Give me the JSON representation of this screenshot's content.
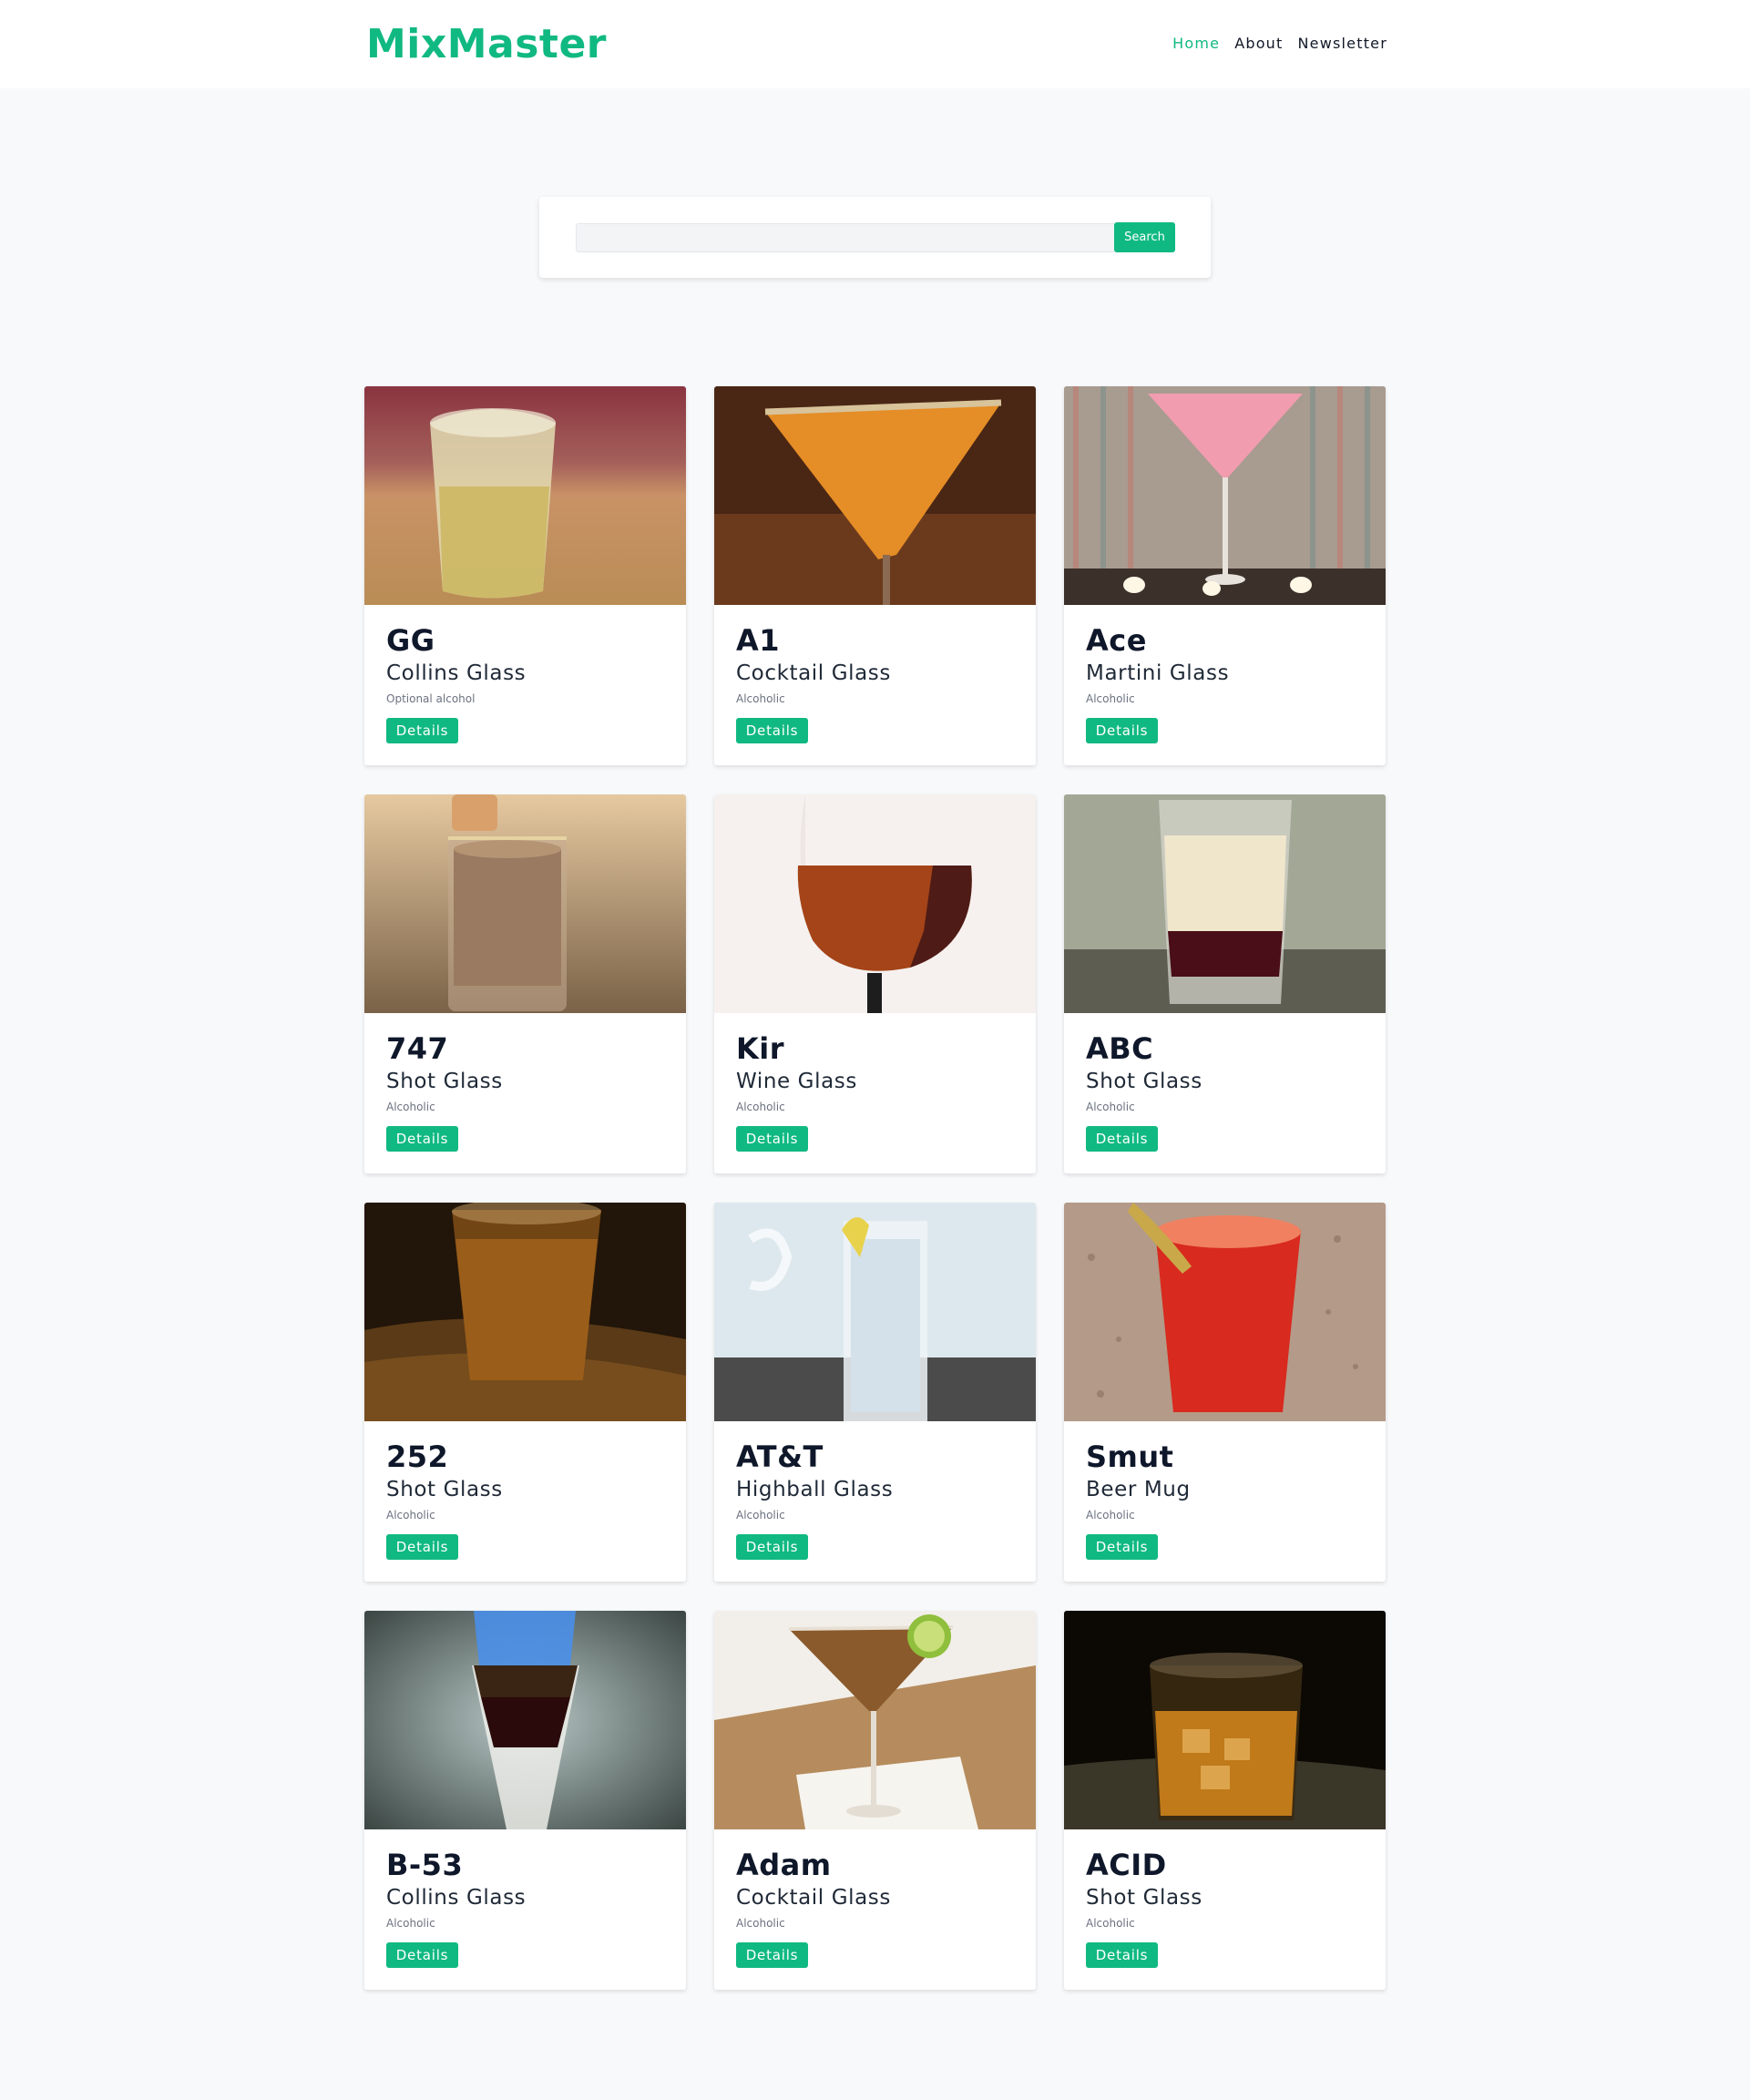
{
  "header": {
    "brand": "MixMaster",
    "nav": [
      {
        "label": "Home",
        "active": true
      },
      {
        "label": "About",
        "active": false
      },
      {
        "label": "Newsletter",
        "active": false
      }
    ]
  },
  "search": {
    "value": "",
    "placeholder": "",
    "button_label": "Search"
  },
  "colors": {
    "accent": "#10b981",
    "background": "#f8f9fb"
  },
  "drinks": [
    {
      "name": "GG",
      "glass": "Collins Glass",
      "alcohol": "Optional alcohol",
      "button": "Details",
      "image": "glass-of-yellow-drink-on-ice"
    },
    {
      "name": "A1",
      "glass": "Cocktail Glass",
      "alcohol": "Alcoholic",
      "button": "Details",
      "image": "orange-drink-sugar-rim-cocktail-glass"
    },
    {
      "name": "Ace",
      "glass": "Martini Glass",
      "alcohol": "Alcoholic",
      "button": "Details",
      "image": "pink-drink-martini-glass-with-candles"
    },
    {
      "name": "747",
      "glass": "Shot Glass",
      "alcohol": "Alcoholic",
      "button": "Details",
      "image": "creamy-brown-shot"
    },
    {
      "name": "Kir",
      "glass": "Wine Glass",
      "alcohol": "Alcoholic",
      "button": "Details",
      "image": "red-drink-wine-glass"
    },
    {
      "name": "ABC",
      "glass": "Shot Glass",
      "alcohol": "Alcoholic",
      "button": "Details",
      "image": "layered-cream-and-red-shot"
    },
    {
      "name": "252",
      "glass": "Shot Glass",
      "alcohol": "Alcoholic",
      "button": "Details",
      "image": "amber-shot-on-wood"
    },
    {
      "name": "AT&T",
      "glass": "Highball Glass",
      "alcohol": "Alcoholic",
      "button": "Details",
      "image": "clear-highball-with-lemon"
    },
    {
      "name": "Smut",
      "glass": "Beer Mug",
      "alcohol": "Alcoholic",
      "button": "Details",
      "image": "red-frothy-drink-with-garnish"
    },
    {
      "name": "B-53",
      "glass": "Collins Glass",
      "alcohol": "Alcoholic",
      "button": "Details",
      "image": "flaming-layered-shooter"
    },
    {
      "name": "Adam",
      "glass": "Cocktail Glass",
      "alcohol": "Alcoholic",
      "button": "Details",
      "image": "brown-cocktail-with-lime"
    },
    {
      "name": "ACID",
      "glass": "Shot Glass",
      "alcohol": "Alcoholic",
      "button": "Details",
      "image": "whiskey-on-rocks"
    }
  ]
}
